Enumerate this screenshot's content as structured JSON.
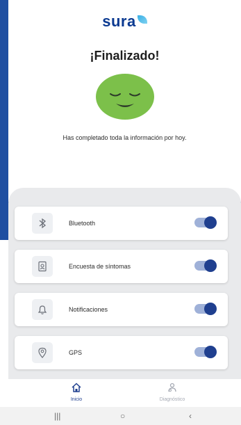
{
  "app": {
    "logo_text": "sura"
  },
  "header": {
    "title": "¡Finalizado!",
    "subtitle": "Has completado toda la información por hoy."
  },
  "permissions": [
    {
      "label": "Bluetooth",
      "icon": "bluetooth-icon",
      "enabled": true
    },
    {
      "label": "Encuesta de síntomas",
      "icon": "survey-icon",
      "enabled": true
    },
    {
      "label": "Notificaciones",
      "icon": "bell-icon",
      "enabled": true
    },
    {
      "label": "GPS",
      "icon": "location-pin-icon",
      "enabled": true
    }
  ],
  "bottom_nav": [
    {
      "label": "Inicio",
      "icon": "home-icon",
      "active": true
    },
    {
      "label": "Diagnóstico",
      "icon": "diagnosis-icon",
      "active": false
    }
  ],
  "colors": {
    "brand_blue": "#1f4fa1",
    "toggle_on": "#1f3f8f",
    "face_green": "#7cc04a"
  }
}
